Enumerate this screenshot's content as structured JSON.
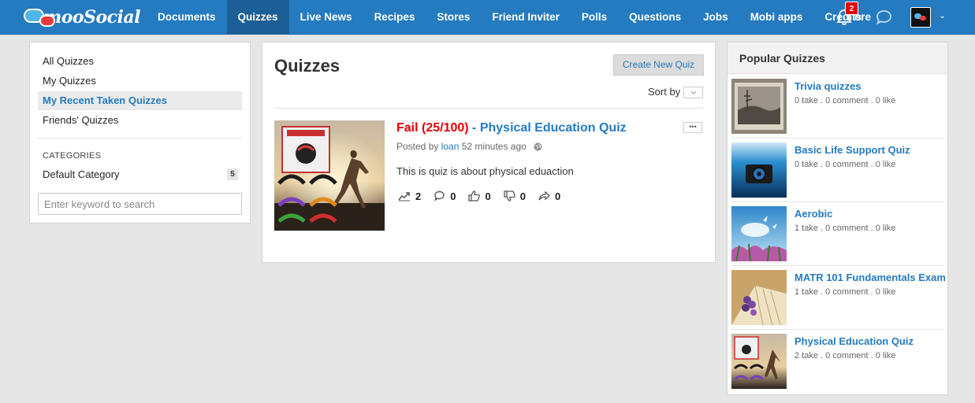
{
  "header": {
    "logo_text": "mooSocial",
    "nav": [
      {
        "label": "Documents"
      },
      {
        "label": "Quizzes"
      },
      {
        "label": "Live News"
      },
      {
        "label": "Recipes"
      },
      {
        "label": "Stores"
      },
      {
        "label": "Friend Inviter"
      },
      {
        "label": "Polls"
      },
      {
        "label": "Questions"
      },
      {
        "label": "Jobs"
      },
      {
        "label": "Mobi apps"
      },
      {
        "label": "Credits"
      }
    ],
    "active_nav": "Quizzes",
    "notification_count": "2",
    "more_visible_text": "ore",
    "accent_color": "#247bc0"
  },
  "sidebar": {
    "menu": [
      {
        "label": "All Quizzes"
      },
      {
        "label": "My Quizzes"
      },
      {
        "label": "My Recent Taken Quizzes"
      },
      {
        "label": "Friends' Quizzes"
      }
    ],
    "active_menu": "My Recent Taken Quizzes",
    "categories_heading": "CATEGORIES",
    "categories": [
      {
        "label": "Default Category",
        "count": "5"
      }
    ],
    "search_placeholder": "Enter keyword to search"
  },
  "main": {
    "title": "Quizzes",
    "create_button": "Create New Quiz",
    "sort_label": "Sort by",
    "quiz": {
      "result": "Fail (25/100)",
      "separator": " - ",
      "title": "Physical Education Quiz",
      "posted_prefix": "Posted by",
      "author": "loan",
      "time_ago": "52 minutes ago",
      "description": "This is quiz is about physical eduaction",
      "stats": {
        "takes": "2",
        "comments": "0",
        "likes": "0",
        "dislikes": "0",
        "shares": "0"
      }
    }
  },
  "popular": {
    "heading": "Popular Quizzes",
    "items": [
      {
        "title": "Trivia quizzes",
        "meta": "0 take . 0 comment . 0 like"
      },
      {
        "title": "Basic Life Support Quiz",
        "meta": "0 take . 0 comment . 0 like"
      },
      {
        "title": "Aerobic",
        "meta": "1 take . 0 comment . 0 like"
      },
      {
        "title": "MATR 101 Fundamentals Exam",
        "meta": "1 take . 0 comment . 0 like"
      },
      {
        "title": "Physical Education Quiz",
        "meta": "2 take . 0 comment . 0 like"
      }
    ]
  }
}
